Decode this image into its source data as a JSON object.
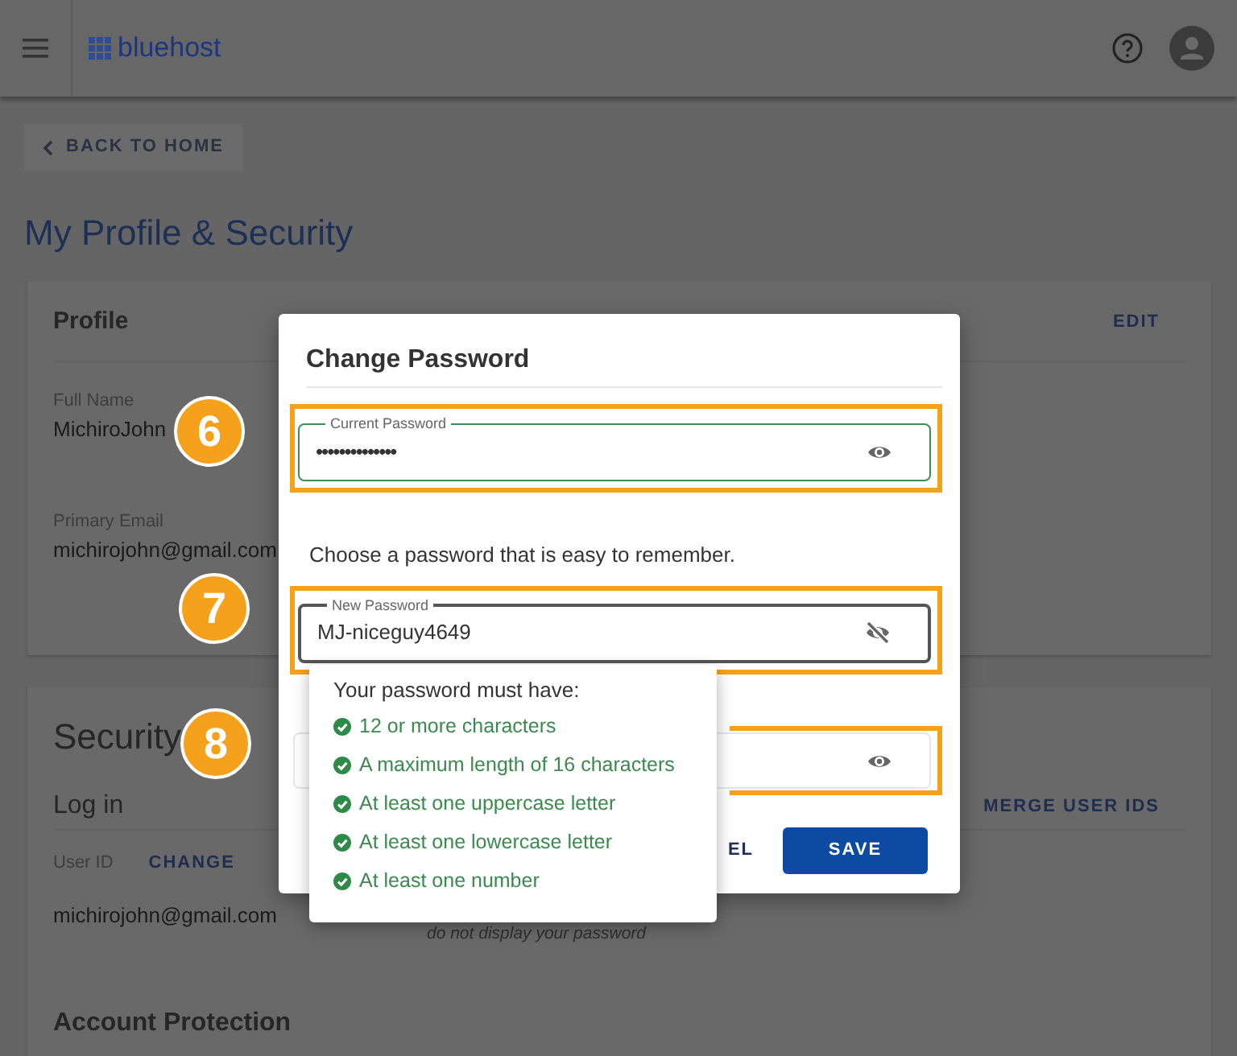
{
  "header": {
    "logo": "bluehost"
  },
  "back_button": "BACK TO HOME",
  "title": "My Profile & Security",
  "profile": {
    "title": "Profile",
    "action": "EDIT",
    "fields": [
      {
        "label": "Full Name",
        "value": "MichiroJohn"
      },
      {
        "label": "Primary Email",
        "value": "michirojohn@gmail.com"
      }
    ]
  },
  "security": {
    "title": "Security",
    "login": {
      "title": "Log in",
      "action": "MERGE USER IDS",
      "user_id_label": "User ID",
      "change": "CHANGE",
      "user_id": "michirojohn@gmail.com",
      "password_note": "do not display your password"
    },
    "account_protection": "Account Protection"
  },
  "dialog": {
    "title": "Change Password",
    "fields": [
      {
        "label": "Current Password",
        "value": "••••••••••••••",
        "masked": true,
        "valid": true,
        "focused": false
      },
      {
        "label": "New Password",
        "value": "MJ-niceguy4649",
        "masked": false,
        "valid": false,
        "focused": true
      },
      {
        "masked": true,
        "valid": false,
        "focused": false
      }
    ],
    "hint": "Choose a password that is easy to remember.",
    "buttons": [
      {
        "label": "EL",
        "kind": "text"
      },
      {
        "label": "SAVE",
        "kind": "primary"
      }
    ]
  },
  "requirements": {
    "title": "Your password must have:",
    "rules": [
      {
        "text": "12 or more characters",
        "met": true
      },
      {
        "text": "A maximum length of 16 characters",
        "met": true
      },
      {
        "text": "At least one uppercase letter",
        "met": true
      },
      {
        "text": "At least one lowercase letter",
        "met": true
      },
      {
        "text": "At least one number",
        "met": true
      }
    ]
  },
  "callouts": [
    {
      "number": "6"
    },
    {
      "number": "7"
    },
    {
      "number": "8"
    }
  ]
}
